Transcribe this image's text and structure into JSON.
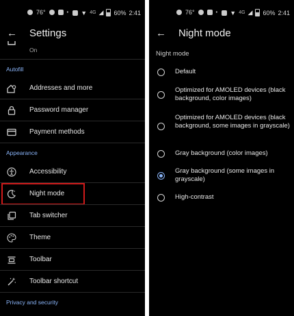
{
  "left": {
    "status": {
      "temp": "76°",
      "battery": "60%",
      "time": "2:41",
      "network": "4G"
    },
    "title": "Settings",
    "partial_value": "On",
    "sections": {
      "autofill": "Autofill",
      "appearance": "Appearance",
      "privacy": "Privacy and security"
    },
    "items": {
      "addresses": "Addresses and more",
      "passwords": "Password manager",
      "payments": "Payment methods",
      "accessibility": "Accessibility",
      "night_mode": "Night mode",
      "tab_switcher": "Tab switcher",
      "theme": "Theme",
      "toolbar": "Toolbar",
      "toolbar_shortcut": "Toolbar shortcut"
    },
    "highlight_color": "#d11a1a"
  },
  "right": {
    "status": {
      "temp": "76°",
      "battery": "60%",
      "time": "2:41",
      "network": "4G"
    },
    "title": "Night mode",
    "subheader": "Night mode",
    "options": [
      {
        "label": "Default",
        "selected": false
      },
      {
        "label": "Optimized for AMOLED devices (black background, color images)",
        "selected": false
      },
      {
        "label": "Optimized for AMOLED devices (black background, some images in grayscale)",
        "selected": false
      },
      {
        "label": "Gray background (color images)",
        "selected": false
      },
      {
        "label": "Gray background (some images in grayscale)",
        "selected": true
      },
      {
        "label": "High-contrast",
        "selected": false
      }
    ],
    "accent_color": "#8ab4f8"
  }
}
